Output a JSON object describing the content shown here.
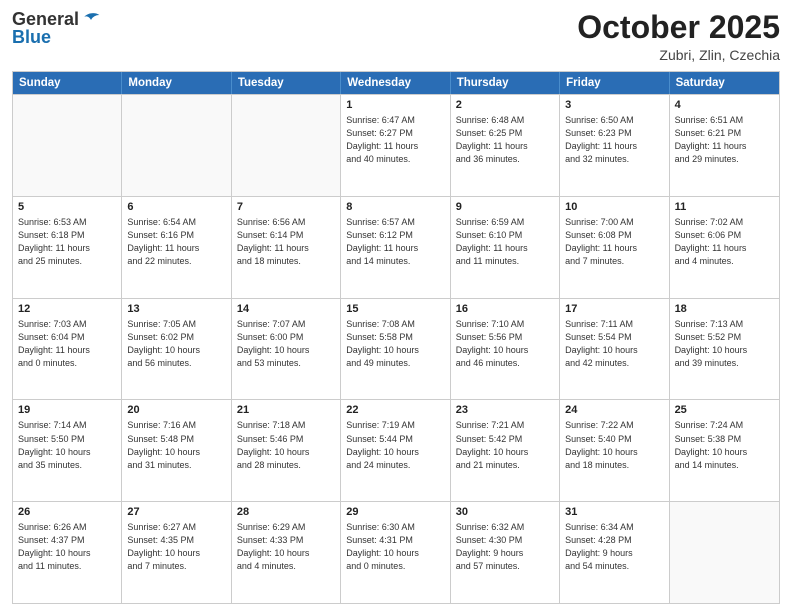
{
  "header": {
    "logo_general": "General",
    "logo_blue": "Blue",
    "month_title": "October 2025",
    "location": "Zubri, Zlin, Czechia"
  },
  "weekdays": [
    "Sunday",
    "Monday",
    "Tuesday",
    "Wednesday",
    "Thursday",
    "Friday",
    "Saturday"
  ],
  "rows": [
    [
      {
        "day": "",
        "info": ""
      },
      {
        "day": "",
        "info": ""
      },
      {
        "day": "",
        "info": ""
      },
      {
        "day": "1",
        "info": "Sunrise: 6:47 AM\nSunset: 6:27 PM\nDaylight: 11 hours\nand 40 minutes."
      },
      {
        "day": "2",
        "info": "Sunrise: 6:48 AM\nSunset: 6:25 PM\nDaylight: 11 hours\nand 36 minutes."
      },
      {
        "day": "3",
        "info": "Sunrise: 6:50 AM\nSunset: 6:23 PM\nDaylight: 11 hours\nand 32 minutes."
      },
      {
        "day": "4",
        "info": "Sunrise: 6:51 AM\nSunset: 6:21 PM\nDaylight: 11 hours\nand 29 minutes."
      }
    ],
    [
      {
        "day": "5",
        "info": "Sunrise: 6:53 AM\nSunset: 6:18 PM\nDaylight: 11 hours\nand 25 minutes."
      },
      {
        "day": "6",
        "info": "Sunrise: 6:54 AM\nSunset: 6:16 PM\nDaylight: 11 hours\nand 22 minutes."
      },
      {
        "day": "7",
        "info": "Sunrise: 6:56 AM\nSunset: 6:14 PM\nDaylight: 11 hours\nand 18 minutes."
      },
      {
        "day": "8",
        "info": "Sunrise: 6:57 AM\nSunset: 6:12 PM\nDaylight: 11 hours\nand 14 minutes."
      },
      {
        "day": "9",
        "info": "Sunrise: 6:59 AM\nSunset: 6:10 PM\nDaylight: 11 hours\nand 11 minutes."
      },
      {
        "day": "10",
        "info": "Sunrise: 7:00 AM\nSunset: 6:08 PM\nDaylight: 11 hours\nand 7 minutes."
      },
      {
        "day": "11",
        "info": "Sunrise: 7:02 AM\nSunset: 6:06 PM\nDaylight: 11 hours\nand 4 minutes."
      }
    ],
    [
      {
        "day": "12",
        "info": "Sunrise: 7:03 AM\nSunset: 6:04 PM\nDaylight: 11 hours\nand 0 minutes."
      },
      {
        "day": "13",
        "info": "Sunrise: 7:05 AM\nSunset: 6:02 PM\nDaylight: 10 hours\nand 56 minutes."
      },
      {
        "day": "14",
        "info": "Sunrise: 7:07 AM\nSunset: 6:00 PM\nDaylight: 10 hours\nand 53 minutes."
      },
      {
        "day": "15",
        "info": "Sunrise: 7:08 AM\nSunset: 5:58 PM\nDaylight: 10 hours\nand 49 minutes."
      },
      {
        "day": "16",
        "info": "Sunrise: 7:10 AM\nSunset: 5:56 PM\nDaylight: 10 hours\nand 46 minutes."
      },
      {
        "day": "17",
        "info": "Sunrise: 7:11 AM\nSunset: 5:54 PM\nDaylight: 10 hours\nand 42 minutes."
      },
      {
        "day": "18",
        "info": "Sunrise: 7:13 AM\nSunset: 5:52 PM\nDaylight: 10 hours\nand 39 minutes."
      }
    ],
    [
      {
        "day": "19",
        "info": "Sunrise: 7:14 AM\nSunset: 5:50 PM\nDaylight: 10 hours\nand 35 minutes."
      },
      {
        "day": "20",
        "info": "Sunrise: 7:16 AM\nSunset: 5:48 PM\nDaylight: 10 hours\nand 31 minutes."
      },
      {
        "day": "21",
        "info": "Sunrise: 7:18 AM\nSunset: 5:46 PM\nDaylight: 10 hours\nand 28 minutes."
      },
      {
        "day": "22",
        "info": "Sunrise: 7:19 AM\nSunset: 5:44 PM\nDaylight: 10 hours\nand 24 minutes."
      },
      {
        "day": "23",
        "info": "Sunrise: 7:21 AM\nSunset: 5:42 PM\nDaylight: 10 hours\nand 21 minutes."
      },
      {
        "day": "24",
        "info": "Sunrise: 7:22 AM\nSunset: 5:40 PM\nDaylight: 10 hours\nand 18 minutes."
      },
      {
        "day": "25",
        "info": "Sunrise: 7:24 AM\nSunset: 5:38 PM\nDaylight: 10 hours\nand 14 minutes."
      }
    ],
    [
      {
        "day": "26",
        "info": "Sunrise: 6:26 AM\nSunset: 4:37 PM\nDaylight: 10 hours\nand 11 minutes."
      },
      {
        "day": "27",
        "info": "Sunrise: 6:27 AM\nSunset: 4:35 PM\nDaylight: 10 hours\nand 7 minutes."
      },
      {
        "day": "28",
        "info": "Sunrise: 6:29 AM\nSunset: 4:33 PM\nDaylight: 10 hours\nand 4 minutes."
      },
      {
        "day": "29",
        "info": "Sunrise: 6:30 AM\nSunset: 4:31 PM\nDaylight: 10 hours\nand 0 minutes."
      },
      {
        "day": "30",
        "info": "Sunrise: 6:32 AM\nSunset: 4:30 PM\nDaylight: 9 hours\nand 57 minutes."
      },
      {
        "day": "31",
        "info": "Sunrise: 6:34 AM\nSunset: 4:28 PM\nDaylight: 9 hours\nand 54 minutes."
      },
      {
        "day": "",
        "info": ""
      }
    ]
  ]
}
